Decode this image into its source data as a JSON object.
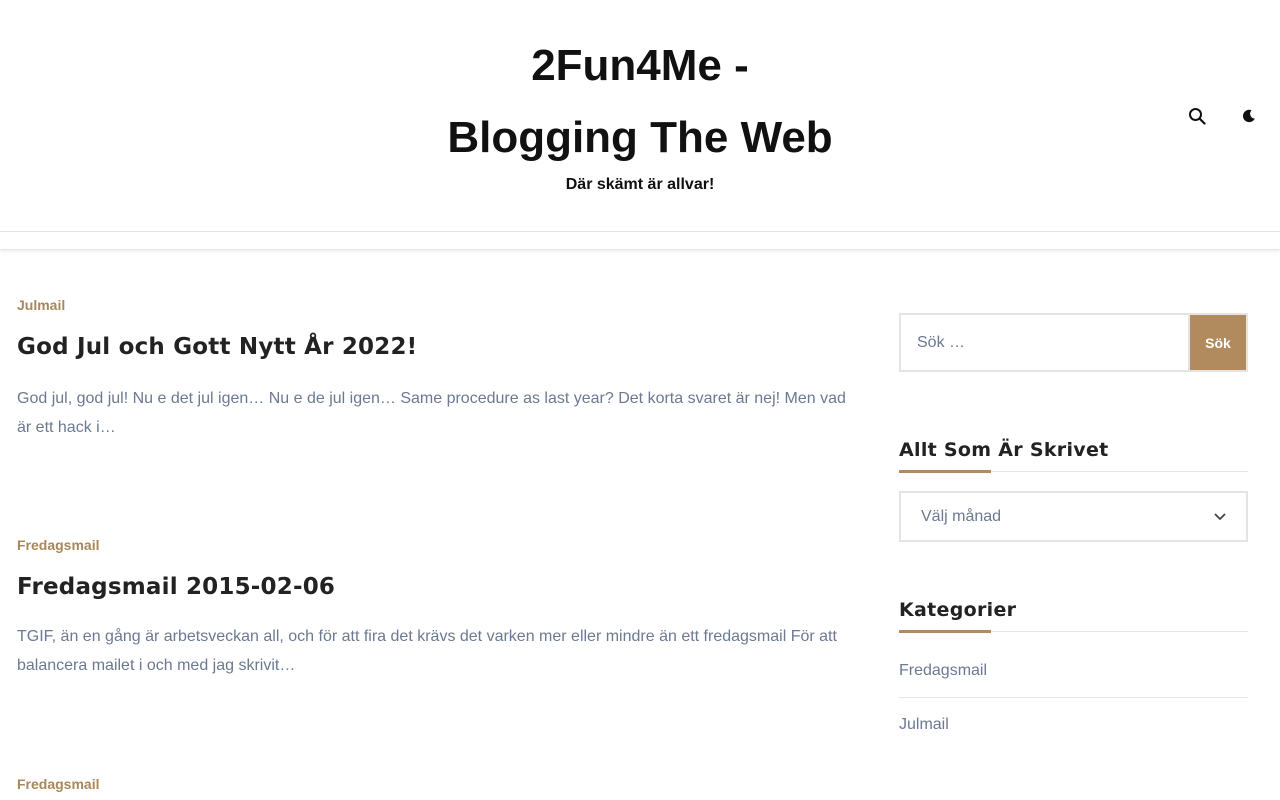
{
  "header": {
    "title_line1": "2Fun4Me -",
    "title_line2": "Blogging The Web",
    "tagline": "Där skämt är allvar!",
    "search_icon": "search-icon",
    "dark_mode_icon": "moon-icon"
  },
  "posts": [
    {
      "category": "Julmail",
      "title": "God Jul och Gott Nytt År 2022!",
      "excerpt": "God jul, god jul! Nu e det jul igen… Nu e de jul igen… Same procedure as last year? Det korta svaret är nej! Men vad är ett hack i…"
    },
    {
      "category": "Fredagsmail",
      "title": "Fredagsmail 2015-02-06",
      "excerpt": "TGIF, än en gång är arbetsveckan all, och för att fira det krävs det varken mer eller mindre än ett fredagsmail För att balancera mailet i och med jag skrivit…"
    },
    {
      "category": "Fredagsmail"
    }
  ],
  "sidebar": {
    "search": {
      "placeholder": "Sök …",
      "button_label": "Sök"
    },
    "archive": {
      "title": "Allt Som Är Skrivet",
      "selected": "Välj månad"
    },
    "categories": {
      "title": "Kategorier",
      "items": [
        "Fredagsmail",
        "Julmail"
      ]
    }
  },
  "colors": {
    "accent": "#b18b5e",
    "category_text": "#a8875b",
    "body_text": "#6b7a90",
    "heading": "#222222"
  }
}
